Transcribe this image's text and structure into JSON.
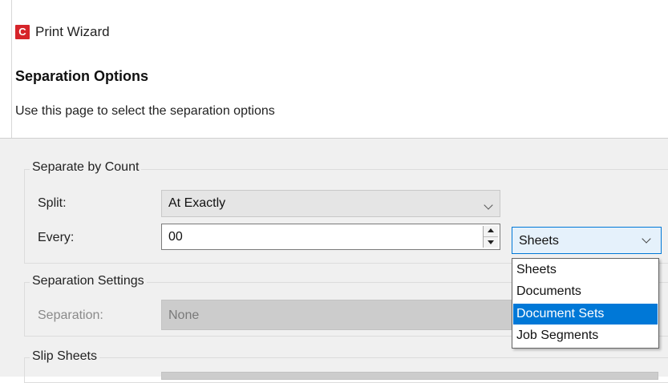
{
  "window": {
    "app_icon_letter": "C",
    "title": "Print Wizard"
  },
  "page": {
    "title": "Separation Options",
    "description": "Use this page to select the separation options"
  },
  "separate_by_count": {
    "group_label": "Separate by Count",
    "split_label": "Split:",
    "split_value": "At Exactly",
    "every_label": "Every:",
    "every_value": "00",
    "unit_value": "Sheets",
    "unit_options": [
      "Sheets",
      "Documents",
      "Document Sets",
      "Job Segments"
    ],
    "highlighted_option": "Document Sets"
  },
  "separation_settings": {
    "group_label": "Separation Settings",
    "separation_label": "Separation:",
    "separation_value": "None"
  },
  "slip_sheets": {
    "group_label": "Slip Sheets"
  },
  "colors": {
    "accent": "#0078d7",
    "app_icon_red": "#d6242a",
    "panel_bg": "#f0f0f0"
  }
}
